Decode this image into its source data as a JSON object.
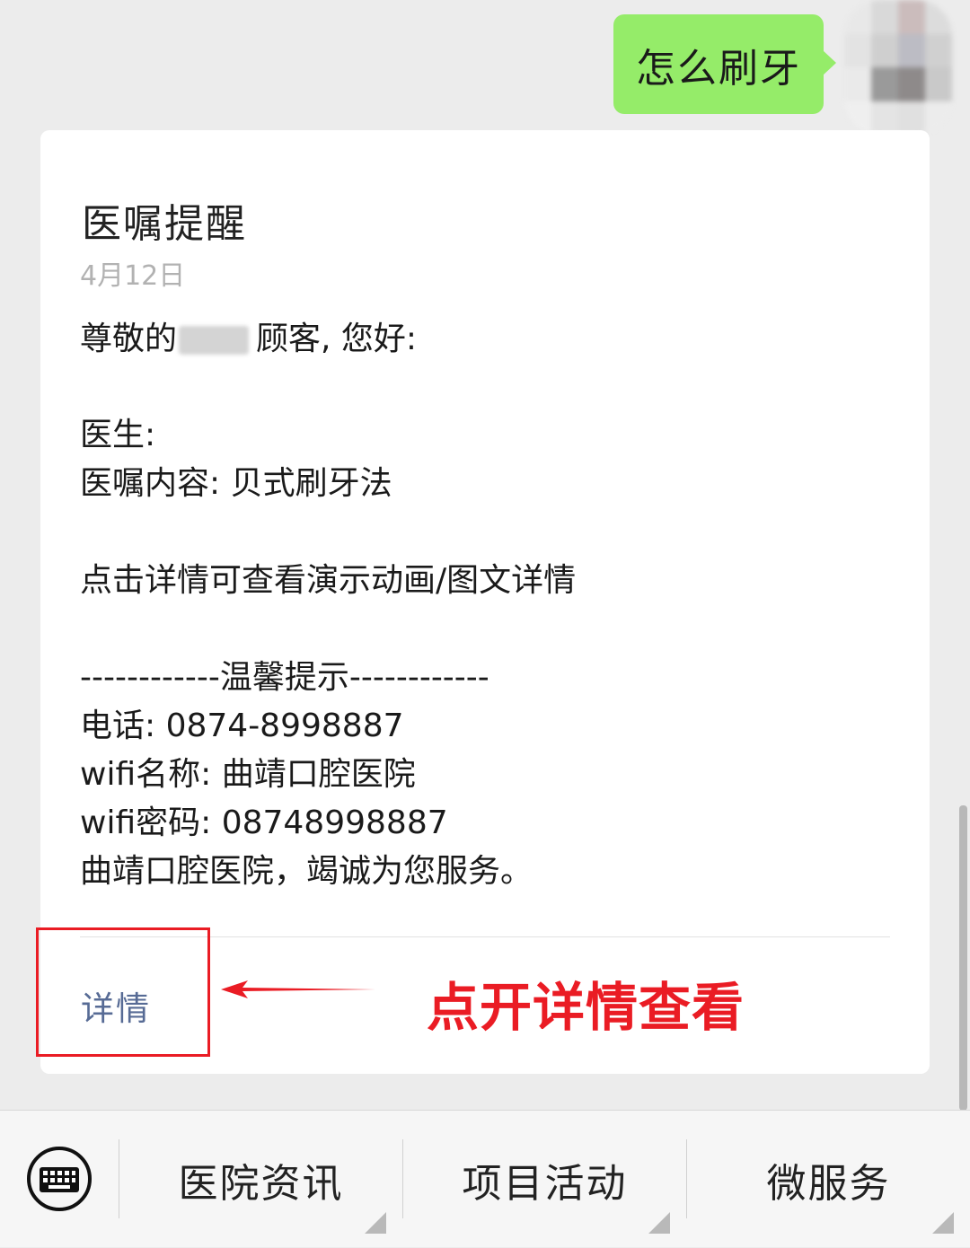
{
  "chat": {
    "outgoing_message": "怎么刷牙"
  },
  "card": {
    "title": "医嘱提醒",
    "date": "4月12日",
    "greeting_prefix": "尊敬的",
    "greeting_suffix": "顾客, 您好:",
    "doctor_line": "医生:",
    "advice_line": "医嘱内容: 贝式刷牙法",
    "hint_line": "点击详情可查看演示动画/图文详情",
    "tips_header": "------------温馨提示------------",
    "phone_line": "电话: 0874-8998887",
    "wifi_name_line": "wifi名称: 曲靖口腔医院",
    "wifi_password_line": "wifi密码: 08748998887",
    "closing_line": "曲靖口腔医院，竭诚为您服务。",
    "detail_link": "详情"
  },
  "annotation": {
    "text": "点开详情查看",
    "color": "#ea1c24"
  },
  "bottom_menu": {
    "items": [
      {
        "label": "医院资讯"
      },
      {
        "label": "项目活动"
      },
      {
        "label": "微服务"
      }
    ]
  },
  "colors": {
    "outgoing_bubble": "#95ec69",
    "link": "#576b95",
    "background": "#ececec"
  }
}
